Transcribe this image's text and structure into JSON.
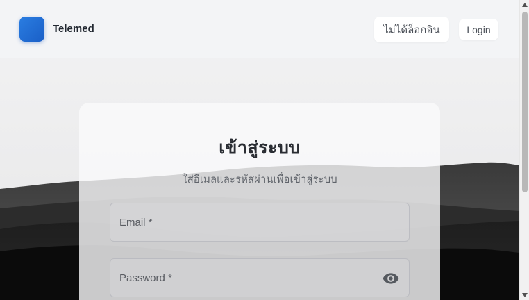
{
  "header": {
    "brand": "Telemed",
    "offline_button": "ไม่ได้ล็อกอิน",
    "login_button": "Login"
  },
  "login_card": {
    "title": "เข้าสู่ระบบ",
    "subtitle": "ใส่อีเมลและรหัสผ่านเพื่อเข้าสู่ระบบ",
    "email_label": "Email *",
    "password_label": "Password *",
    "password_toggle_icon": "eye-icon"
  },
  "colors": {
    "brand_accent": "#1f6fd6",
    "header_bg": "#f3f4f6",
    "mountain_dark": "#0b0b0b"
  }
}
